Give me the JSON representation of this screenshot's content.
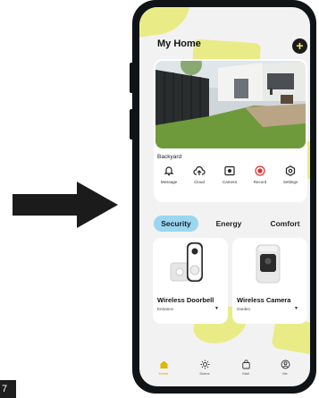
{
  "page_number": "7",
  "app": {
    "title": "My Home",
    "add_label": "+"
  },
  "camera_card": {
    "label": "Backyard",
    "actions": [
      {
        "label": "Message",
        "icon": "bell-icon"
      },
      {
        "label": "Cloud",
        "icon": "cloud-upload-icon"
      },
      {
        "label": "Camera",
        "icon": "camera-icon"
      },
      {
        "label": "Record",
        "icon": "record-icon"
      },
      {
        "label": "Settings",
        "icon": "gear-icon"
      }
    ]
  },
  "tabs": [
    {
      "label": "Security",
      "active": true
    },
    {
      "label": "Energy",
      "active": false
    },
    {
      "label": "Comfort",
      "active": false
    }
  ],
  "devices": [
    {
      "name": "Wireless Doorbell",
      "room": "Entrance"
    },
    {
      "name": "Wireless Camera",
      "room": "Garden"
    }
  ],
  "bottom_nav": [
    {
      "label": "Home",
      "icon": "home-icon",
      "active": true
    },
    {
      "label": "Scene",
      "icon": "sun-icon",
      "active": false
    },
    {
      "label": "Mall",
      "icon": "bag-icon",
      "active": false
    },
    {
      "label": "Me",
      "icon": "user-icon",
      "active": false
    }
  ],
  "colors": {
    "accent_yellow": "#e9ec86",
    "tab_active": "#9bd6f1",
    "nav_active": "#d5a600",
    "record_red": "#e0302c"
  }
}
